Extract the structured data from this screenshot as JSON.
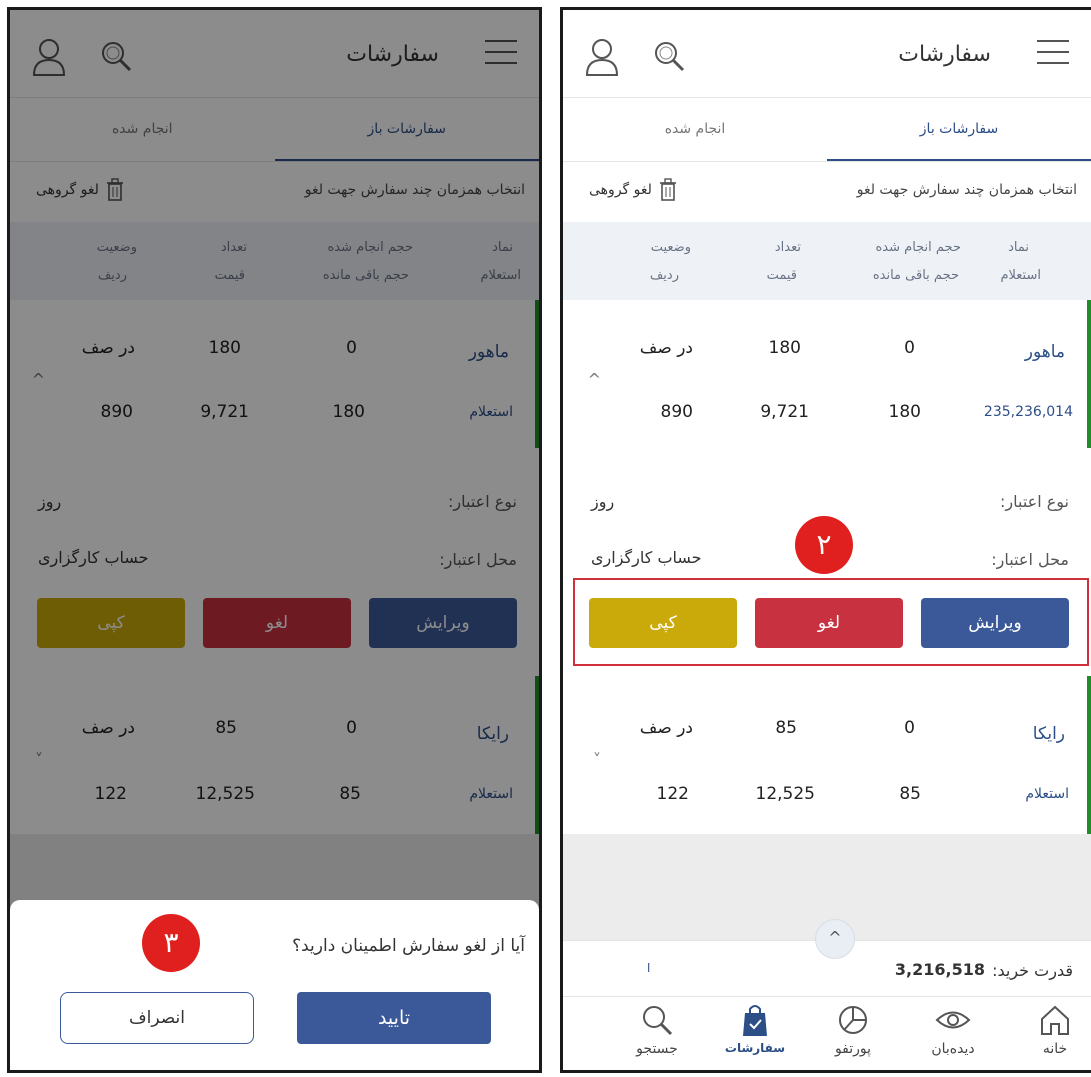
{
  "header": {
    "title": "سفارشات"
  },
  "tabs": {
    "open": "سفارشات باز",
    "done": "انجام شده"
  },
  "selection": {
    "text": "انتخاب همزمان چند سفارش جهت لغو",
    "group_cancel": "لغو گروهی"
  },
  "table_header": {
    "symbol": "نماد",
    "inquiry": "استعلام",
    "done_volume": "حجم انجام شده",
    "remaining_volume": "حجم باقی مانده",
    "count": "تعداد",
    "price": "قیمت",
    "status": "وضعیت",
    "row": "ردیف"
  },
  "orders": [
    {
      "symbol": "ماهور",
      "done": "0",
      "count": "180",
      "status": "در صف",
      "inquiry_left": "استعلام",
      "inquiry_right": "235,236,014",
      "remaining": "180",
      "price": "9,721",
      "row": "890",
      "chevron": "^"
    },
    {
      "symbol": "رایکا",
      "done": "0",
      "count": "85",
      "status": "در صف",
      "inquiry": "استعلام",
      "remaining": "85",
      "price": "12,525",
      "row": "122",
      "chevron": "˅"
    }
  ],
  "details": {
    "validity_type_label": "نوع اعتبار:",
    "validity_type": "روز",
    "validity_place_label": "محل اعتبار:",
    "validity_place": "حساب کارگزاری"
  },
  "actions": {
    "edit": "ویرایش",
    "cancel": "لغو",
    "copy": "کپی"
  },
  "dialog": {
    "question": "آیا از لغو سفارش اطمینان دارید؟",
    "confirm": "تایید",
    "dismiss": "انصراف"
  },
  "badges": {
    "step2": "۲",
    "step3": "۳"
  },
  "footer": {
    "buying_power_label": "قدرت خرید:",
    "buying_power": "3,216,518",
    "small_mark": "ا",
    "up": "^"
  },
  "nav": {
    "home": "خانه",
    "watch": "دیده‌بان",
    "portfolio": "پورتفو",
    "orders": "سفارشات",
    "search": "جستجو"
  },
  "colors": {
    "primary": "#3b5998",
    "danger": "#c8313f",
    "warning": "#c9aa0a",
    "queued": "#1e8d2a",
    "badge": "#e0201e"
  }
}
